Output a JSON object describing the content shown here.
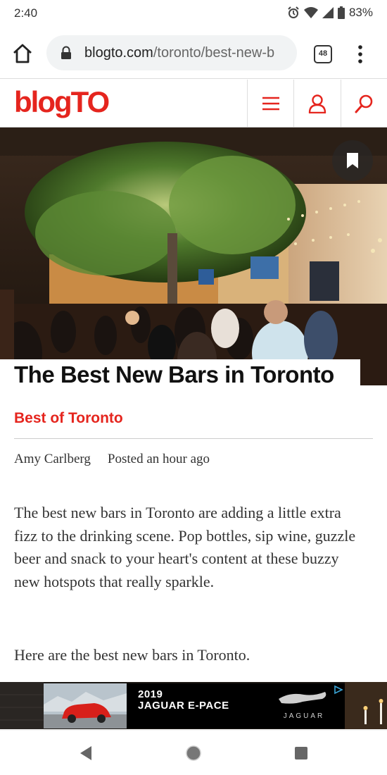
{
  "status_bar": {
    "time": "2:40",
    "battery": "83%"
  },
  "browser": {
    "url_domain": "blogto.com",
    "url_path": "/toronto/best-new-b",
    "tab_count": "48"
  },
  "site": {
    "logo": "blogTO"
  },
  "article": {
    "title": "The Best New Bars in Toronto",
    "category": "Best of Toronto",
    "author": "Amy Carlberg",
    "posted": "Posted an hour ago",
    "paragraphs": [
      "The best new bars in Toronto are adding a little extra fizz to the drinking scene. Pop bottles, sip wine, guzzle beer and snack to your heart's content at these buzzy new hotspots that really sparkle.",
      "Here are the best new bars in Toronto."
    ]
  },
  "ad": {
    "line1": "2019",
    "line2": "JAGUAR E-PACE",
    "brand": "JAGUAR"
  },
  "colors": {
    "brand_red": "#e5251e"
  },
  "icons": [
    "home-icon",
    "lock-icon",
    "tabs-icon",
    "overflow-menu-icon",
    "hamburger-menu-icon",
    "user-icon",
    "search-icon",
    "bookmark-icon",
    "back-icon",
    "home-circle-icon",
    "recents-icon"
  ]
}
